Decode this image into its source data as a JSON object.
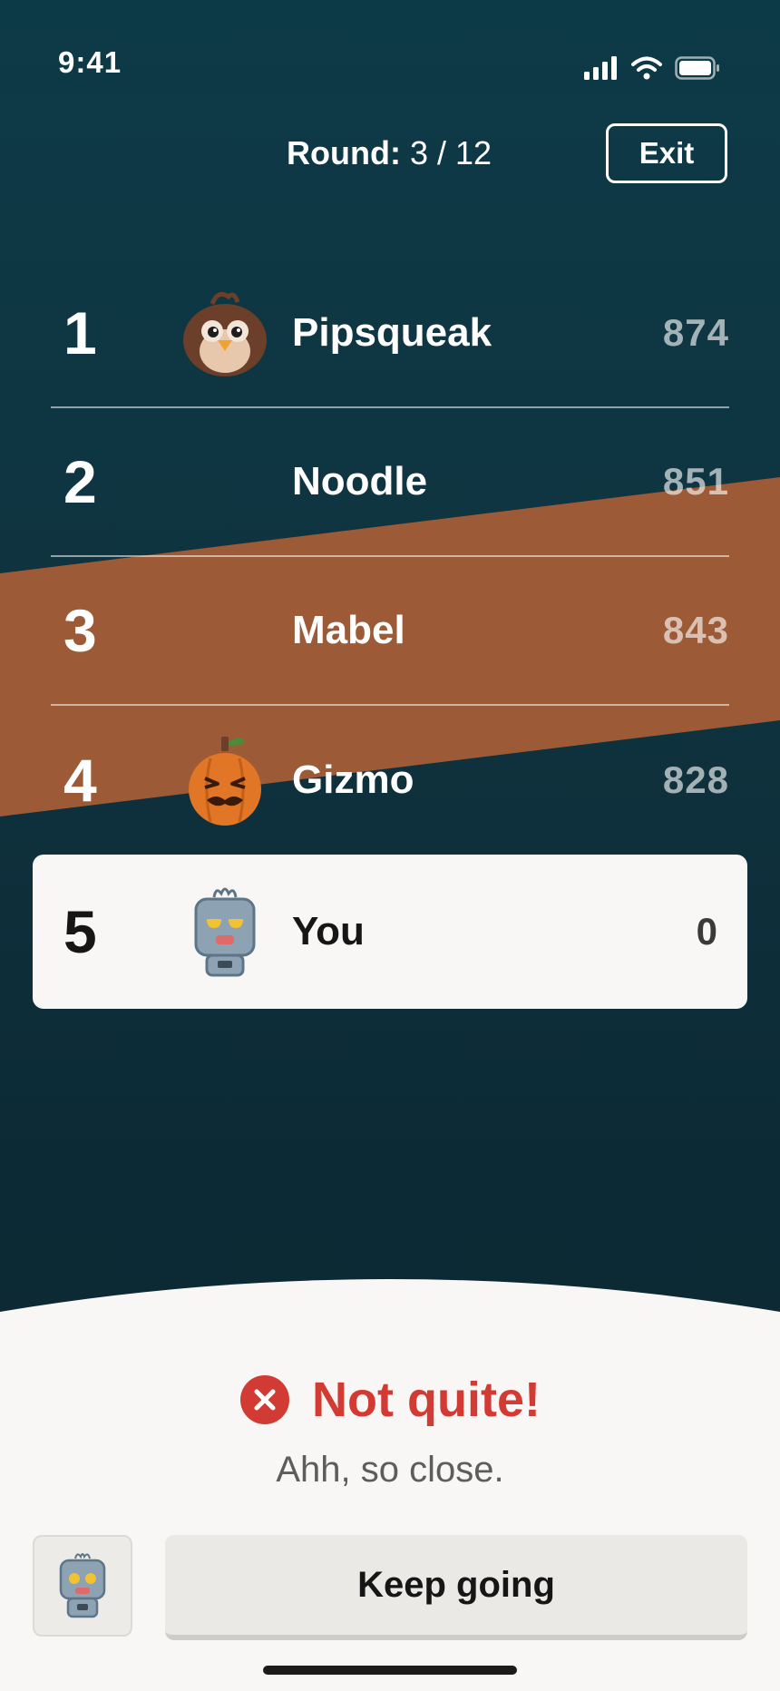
{
  "status_bar": {
    "time": "9:41",
    "icons": [
      "cellular-signal-icon",
      "wifi-icon",
      "battery-icon"
    ]
  },
  "header": {
    "round_label": "Round:",
    "round_value": "3 / 12",
    "exit_label": "Exit"
  },
  "leaderboard": {
    "rows": [
      {
        "rank": "1",
        "name": "Pipsqueak",
        "score": "874",
        "avatar": "owl-avatar"
      },
      {
        "rank": "2",
        "name": "Noodle",
        "score": "851",
        "avatar": ""
      },
      {
        "rank": "3",
        "name": "Mabel",
        "score": "843",
        "avatar": ""
      },
      {
        "rank": "4",
        "name": "Gizmo",
        "score": "828",
        "avatar": "pumpkin-avatar"
      }
    ],
    "you": {
      "rank": "5",
      "name": "You",
      "score": "0",
      "avatar": "robot-avatar"
    }
  },
  "feedback": {
    "icon": "close-circle-icon",
    "title": "Not quite!",
    "subtitle": "Ahh, so close.",
    "mascot_icon": "robot-icon",
    "button_label": "Keep going"
  },
  "colors": {
    "background": "#0f3440",
    "stripe": "#9c5a36",
    "error": "#d23b34",
    "sheet": "#f8f7f5"
  }
}
